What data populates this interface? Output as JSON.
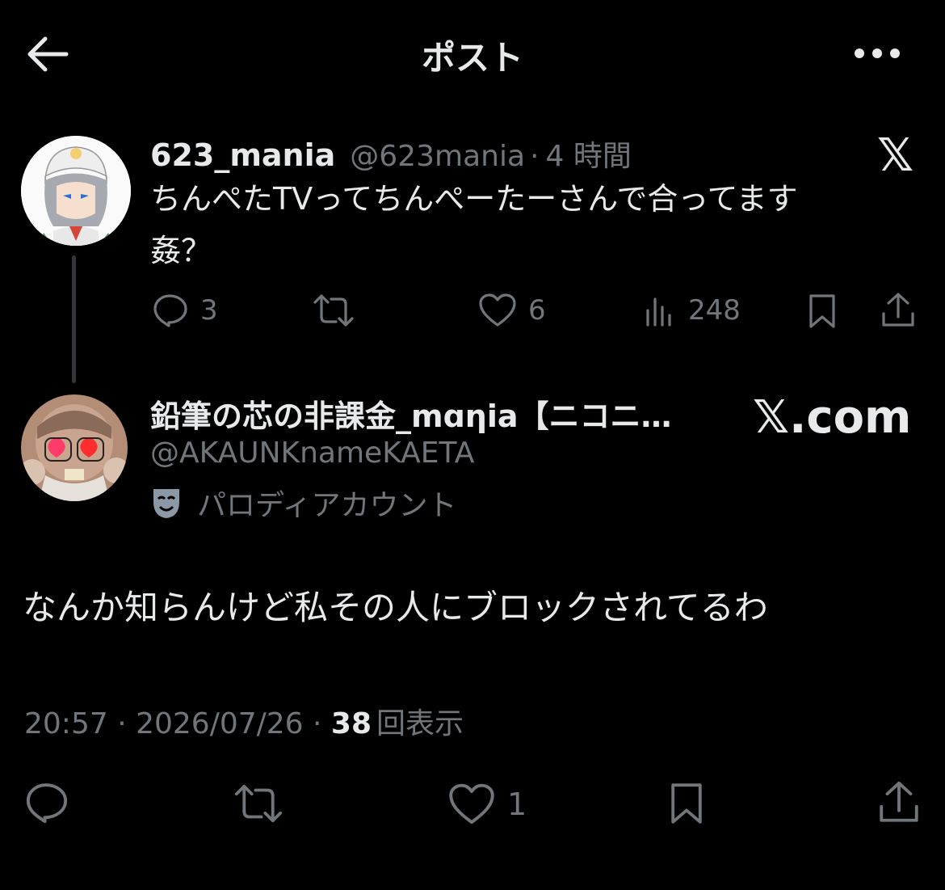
{
  "header": {
    "title": "ポスト",
    "back_icon": "arrow-left-icon",
    "more_icon": "more-horizontal-icon"
  },
  "watermark": {
    "x_logo": "𝕏",
    "x_com": "𝕏.com"
  },
  "reply_to": {
    "display_name": "623_mania",
    "handle": "@623mania",
    "separator": "·",
    "time": "4 時間",
    "text_line1": "ちんぺたTVってちんぺーたーさんで合ってます",
    "text_line2": "姦？",
    "actions": {
      "reply_count": "3",
      "like_count": "6",
      "views_count": "248"
    }
  },
  "main_post": {
    "display_name": "鉛筆の芯の非課金_mɑηia【ニコニ…",
    "handle": "@AKAUNKnameKAETA",
    "badge_label": "パロディアカウント",
    "text": "なんか知らんけど私その人にブロックされてるわ",
    "timestamp": "20:57 · 2026/07/26 · ",
    "views_count": "38",
    "views_label": "回表示",
    "actions": {
      "like_count": "1"
    }
  }
}
